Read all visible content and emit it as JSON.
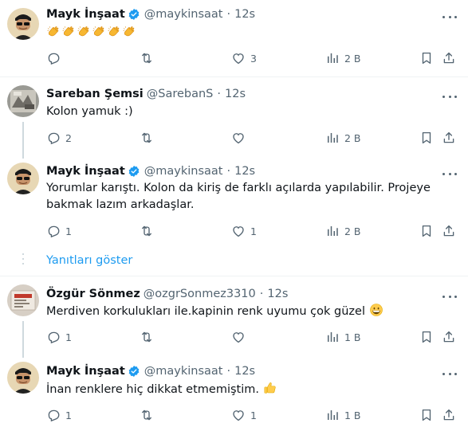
{
  "colors": {
    "accent": "#1d9bf0",
    "text": "#0f1419",
    "muted": "#536471",
    "divider": "#eff3f4"
  },
  "tweets": [
    {
      "name": "Mayk İnşaat",
      "verified": true,
      "handle": "@maykinsaat",
      "time": "12s",
      "text": "",
      "emojis": [
        "clapping-hands",
        "clapping-hands",
        "clapping-hands",
        "clapping-hands",
        "clapping-hands",
        "clapping-hands"
      ],
      "actions": {
        "reply": "",
        "retweet": "",
        "like": "3",
        "views": "2 B"
      }
    },
    {
      "name": "Sareban Şemsi",
      "verified": false,
      "handle": "@SarebanS",
      "time": "12s",
      "text": "Kolon yamuk :)",
      "actions": {
        "reply": "2",
        "retweet": "",
        "like": "",
        "views": "2 B"
      }
    },
    {
      "name": "Mayk İnşaat",
      "verified": true,
      "handle": "@maykinsaat",
      "time": "12s",
      "text": "Yorumlar karıştı.  Kolon da kiriş de farklı açılarda yapılabilir. Projeye bakmak lazım arkadaşlar.",
      "actions": {
        "reply": "1",
        "retweet": "",
        "like": "1",
        "views": "2 B"
      }
    },
    {
      "name": "Özgür Sönmez",
      "verified": false,
      "handle": "@ozgrSonmez3310",
      "time": "12s",
      "text": "Merdiven korkulukları ile.kapinin renk uyumu çok güzel",
      "emoji_after": "grinning-face",
      "actions": {
        "reply": "1",
        "retweet": "",
        "like": "",
        "views": "1 B"
      }
    },
    {
      "name": "Mayk İnşaat",
      "verified": true,
      "handle": "@maykinsaat",
      "time": "12s",
      "text": "İnan renklere hiç dikkat etmemiştim.",
      "emoji_after": "thumbs-up",
      "actions": {
        "reply": "1",
        "retweet": "",
        "like": "1",
        "views": "1 B"
      }
    }
  ],
  "show_replies_label": "Yanıtları göster"
}
